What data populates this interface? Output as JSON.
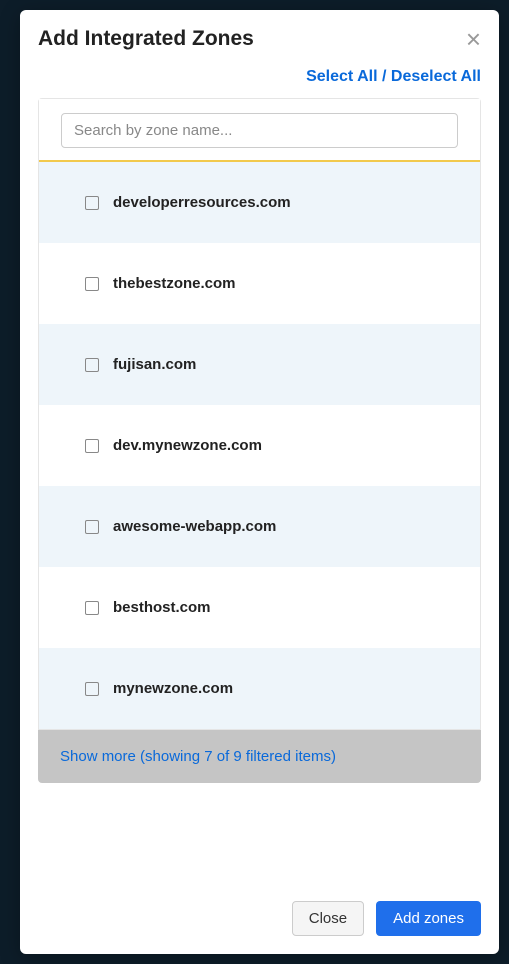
{
  "modal": {
    "title": "Add Integrated Zones",
    "select_all_label": "Select All / Deselect All",
    "search": {
      "placeholder": "Search by zone name..."
    },
    "zones": [
      {
        "name": "developerresources.com"
      },
      {
        "name": "thebestzone.com"
      },
      {
        "name": "fujisan.com"
      },
      {
        "name": "dev.mynewzone.com"
      },
      {
        "name": "awesome-webapp.com"
      },
      {
        "name": "besthost.com"
      },
      {
        "name": "mynewzone.com"
      }
    ],
    "show_more": "Show more (showing 7 of 9 filtered items)",
    "close_label": "Close",
    "add_label": "Add zones"
  }
}
